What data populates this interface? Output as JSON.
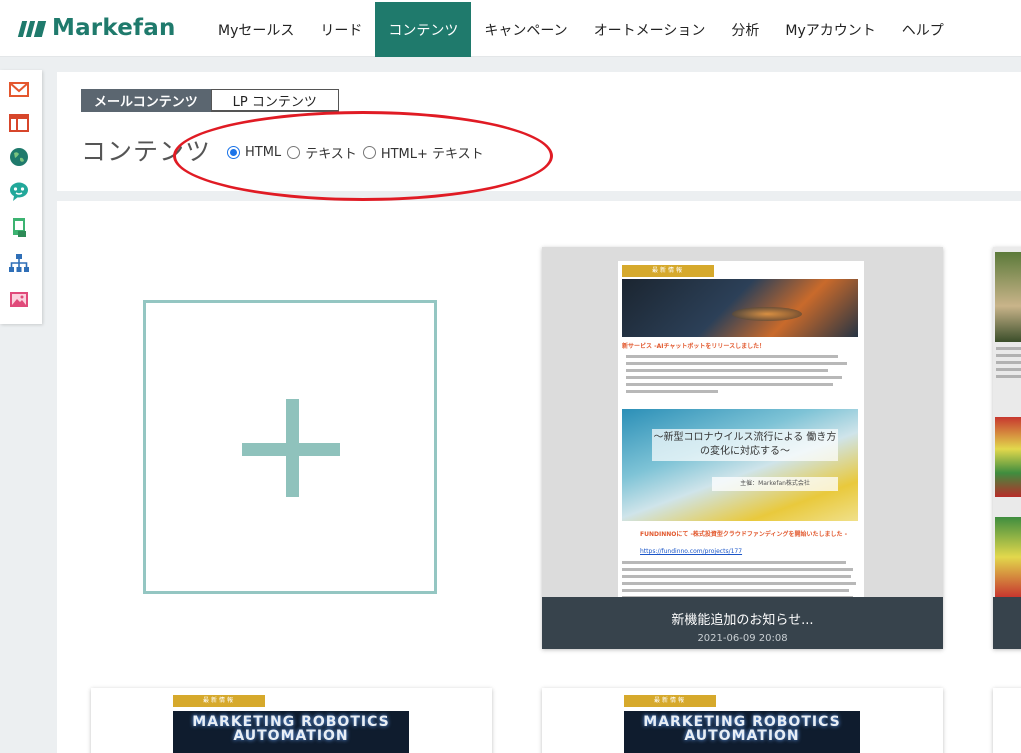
{
  "brand": {
    "name": "Markefan",
    "color": "#1f7a6c"
  },
  "nav": {
    "items": [
      {
        "label": "Myセールス"
      },
      {
        "label": "リード"
      },
      {
        "label": "コンテンツ",
        "active": true
      },
      {
        "label": "キャンペーン"
      },
      {
        "label": "オートメーション"
      },
      {
        "label": "分析"
      },
      {
        "label": "Myアカウント"
      },
      {
        "label": "ヘルプ"
      }
    ]
  },
  "sidebar": {
    "icons": [
      "mail-icon",
      "layout-icon",
      "globe-icon",
      "chat-bot-icon",
      "document-icon",
      "sitemap-icon",
      "image-icon"
    ]
  },
  "tabs": {
    "mail": "メールコンテンツ",
    "lp": "LP コンテンツ"
  },
  "page_title": "コンテンツ",
  "format_options": {
    "selected": "HTML",
    "options": [
      "HTML",
      "テキスト",
      "HTML+ テキスト"
    ]
  },
  "annotation": {
    "color": "#e01b24"
  },
  "cards": {
    "featured": {
      "title": "新機能追加のお知らせ...",
      "date": "2021-06-09 20:08",
      "preview": {
        "badge": "最新情報",
        "headline": "新サービス -AIチャットボットをリリースしました！",
        "banner_text": "～新型コロナウイルス流行による 働き方の変化に対応する～",
        "banner_sub": "主催：Markefan株式会社",
        "headline2": "FUNDINNOにて -株式投資型クラウドファンディングを開始いたしました -",
        "link": "https://fundinno.com/projects/177"
      }
    },
    "bottom": {
      "badge": "最新情報",
      "hero_text": "MARKETING ROBOTICS AUTOMATION"
    }
  }
}
